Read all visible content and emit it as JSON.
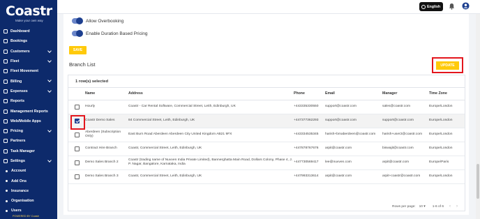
{
  "brand": {
    "logo": "Coastr",
    "tagline": "Make your own way",
    "powered_by": "POWERED BY Coastr"
  },
  "sidebar": {
    "items": [
      {
        "label": "Dashboard",
        "icon": "grid-icon",
        "chevron": false
      },
      {
        "label": "Bookings",
        "icon": "calendar-icon",
        "chevron": false
      },
      {
        "label": "Customers",
        "icon": "users-icon",
        "chevron": true
      },
      {
        "label": "Fleet",
        "icon": "car-icon",
        "chevron": true
      },
      {
        "label": "Fleet Movement",
        "icon": "truck-icon",
        "chevron": false
      },
      {
        "label": "Billing",
        "icon": "billing-icon",
        "chevron": true
      },
      {
        "label": "Expenses",
        "icon": "wallet-icon",
        "chevron": true
      },
      {
        "label": "Reports",
        "icon": "report-icon",
        "chevron": false
      },
      {
        "label": "Management Reports",
        "icon": "chart-icon",
        "chevron": false
      },
      {
        "label": "Web/Mobile Apps",
        "icon": "globe-icon",
        "chevron": false
      },
      {
        "label": "Pricing",
        "icon": "tag-icon",
        "chevron": true
      },
      {
        "label": "Partners",
        "icon": "handshake-icon",
        "chevron": false
      },
      {
        "label": "Task Manager",
        "icon": "tasks-icon",
        "chevron": false
      },
      {
        "label": "Settings",
        "icon": "gear-icon",
        "chevron": true
      }
    ],
    "sub_items": [
      "Account",
      "Add Ons",
      "Insurance",
      "Organisation",
      "Users"
    ]
  },
  "header": {
    "language": "English"
  },
  "settings": {
    "toggles": [
      {
        "label": "Allow Overbooking",
        "on": true
      },
      {
        "label": "Enable Duration Based Pricing",
        "on": true
      }
    ],
    "save_label": "SAVE"
  },
  "branch_list": {
    "title": "Branch List",
    "update_label": "UPDATE",
    "selected_text": "1 row(s) selected",
    "columns": [
      "Name",
      "Address",
      "Phone",
      "Email",
      "Manager",
      "Time Zone"
    ],
    "rows": [
      {
        "name": "Hourly",
        "address": "Coastr - Car Rental Software, Commercial Street, Leith, Edinburgh, UK",
        "phone": "+443335330550",
        "email": "support@coastr.com",
        "manager": "sales@coastr.com",
        "tz": "Europe/London",
        "selected": false
      },
      {
        "name": "Coastr Demo Sales",
        "address": "84 Commercial Street, Leith, Edinburgh, UK",
        "phone": "+447377362293",
        "email": "support@coastr.com",
        "manager": "support@coastr.com",
        "tz": "Europe/London",
        "selected": true
      },
      {
        "name": "Aberdeen (Subscription Only)",
        "address": "East Burn Road Aberdeen Aberdeen City United Kingdom AB21 9FX",
        "phone": "+443334535345",
        "email": "harish+bmaberdeen@coastr.com",
        "manager": "harish+user2@coastr.com",
        "tz": "Europe/London",
        "selected": false
      },
      {
        "name": "Contract Hire Branch",
        "address": "Coastr, Commercial Street, Leith, Edinburgh, UK",
        "phone": "+447878767676",
        "email": "arpit@coastr.com",
        "manager": "biswajit@coastr.com",
        "tz": "Europe/London",
        "selected": false
      },
      {
        "name": "Demo Sales Branch 2",
        "address": "Coastr (trading name of Nuvven India Private Limited), Bannerghatta Main Road, Dollars Colony, Phase 4, J. P. Nagar, Bangalore, Karnataka, India",
        "phone": "+447730569417",
        "email": "lee@nuvven.com",
        "manager": "arpit@coastr.com",
        "tz": "Europe/Paris",
        "selected": false
      },
      {
        "name": "Demo Sales Branch 3",
        "address": "Coastr, Commercial Street, Leith, Edinburgh, UK",
        "phone": "+447993313614",
        "email": "arpit@coastr.com",
        "manager": "arpit+coastr@coastr.com",
        "tz": "Europe/London",
        "selected": false
      }
    ],
    "pagination": {
      "rows_per_page_label": "Rows per page:",
      "rows_per_page": "10",
      "range": "1-6 of 6"
    }
  }
}
